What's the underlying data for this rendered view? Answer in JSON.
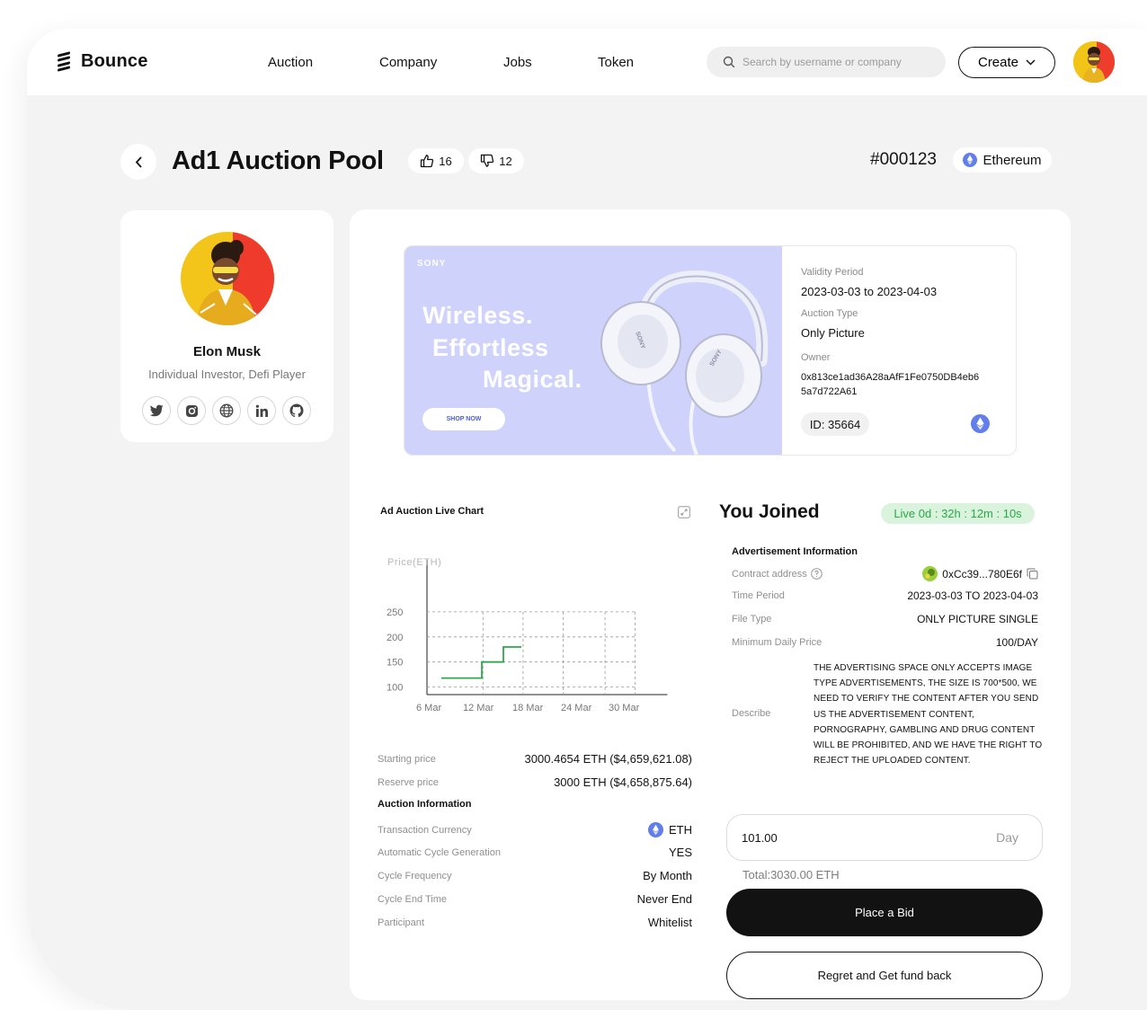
{
  "header": {
    "logo": "Bounce",
    "nav": [
      "Auction",
      "Company",
      "Jobs",
      "Token"
    ],
    "search_placeholder": "Search by username or company",
    "create_label": "Create"
  },
  "pool": {
    "title": "Ad1 Auction Pool",
    "likes": "16",
    "dislikes": "12",
    "id": "#000123",
    "chain": "Ethereum"
  },
  "profile": {
    "name": "Elon Musk",
    "role": "Individual Investor, Defi Player",
    "socials": [
      "twitter-icon",
      "instagram-icon",
      "globe-icon",
      "linkedin-icon",
      "github-icon"
    ]
  },
  "ad": {
    "brand": "SONY",
    "headline": [
      "Wireless.",
      "Effortless",
      "Magical."
    ],
    "cta": "SHOP NOW",
    "headphone_text": "SONY",
    "validity_label": "Validity Period",
    "validity_value": "2023-03-03 to 2023-04-03",
    "type_label": "Auction Type",
    "type_value": "Only Picture",
    "owner_label": "Owner",
    "owner_line1": "0x813ce1ad36A28aAfF1Fe0750DB4eb6",
    "owner_line2": "5a7d722A61",
    "id": "ID: 35664"
  },
  "chart": {
    "title": "Ad Auction Live Chart"
  },
  "chart_data": {
    "type": "line",
    "title": "Ad Auction Live Chart",
    "ylabel": "Price(ETH)",
    "xlabel": "",
    "x_ticks": [
      "6 Mar",
      "12 Mar",
      "18 Mar",
      "24 Mar",
      "30 Mar"
    ],
    "y_ticks": [
      100,
      150,
      200,
      250
    ],
    "ylim": [
      85,
      325
    ],
    "step": true,
    "grid": true,
    "series": [
      {
        "x": [
          "3 Mar",
          "12 Mar",
          "12 Mar",
          "15 Mar",
          "15 Mar",
          "17 Mar"
        ],
        "values": [
          118,
          118,
          150,
          150,
          180,
          180
        ]
      }
    ]
  },
  "pricing": {
    "starting_label": "Starting price",
    "starting_value": "3000.4654 ETH ($4,659,621.08)",
    "reserve_label": "Reserve price",
    "reserve_value": "3000 ETH ($4,658,875.64)"
  },
  "auction_info": {
    "title": "Auction Information",
    "rows": [
      {
        "label": "Transaction Currency",
        "value": "ETH"
      },
      {
        "label": "Automatic Cycle Generation",
        "value": "YES"
      },
      {
        "label": "Cycle Frequency",
        "value": "By Month"
      },
      {
        "label": "Cycle End Time",
        "value": "Never End"
      },
      {
        "label": "Participant",
        "value": "Whitelist"
      }
    ]
  },
  "joined": {
    "title": "You Joined",
    "live": "Live 0d : 32h : 12m : 10s"
  },
  "ad_info": {
    "title": "Advertisement Information",
    "contract_label": "Contract address",
    "contract_value": "0xCc39...780E6f",
    "time_label": "Time Period",
    "time_value": "2023-03-03 TO 2023-04-03",
    "file_label": "File Type",
    "file_value": "ONLY PICTURE SINGLE",
    "price_label": "Minimum Daily Price",
    "price_value": "100/DAY",
    "describe_label": "Describe",
    "describe_value": "THE ADVERTISING SPACE ONLY ACCEPTS IMAGE TYPE ADVERTISEMENTS, THE SIZE IS 700*500, WE NEED TO VERIFY THE CONTENT AFTER YOU SEND US THE ADVERTISEMENT CONTENT, PORNOGRAPHY, GAMBLING AND DRUG CONTENT WILL BE PROHIBITED, AND WE HAVE THE RIGHT TO REJECT THE UPLOADED CONTENT."
  },
  "bid": {
    "value": "101.00",
    "unit": "Day",
    "total": "Total:3030.00 ETH",
    "place_label": "Place a Bid",
    "regret_label": "Regret and Get fund back"
  },
  "colors": {
    "accent_green": "#2aa84a",
    "eth_blue": "#627eea",
    "banner": "#cfd2fb",
    "dark": "#121212"
  }
}
